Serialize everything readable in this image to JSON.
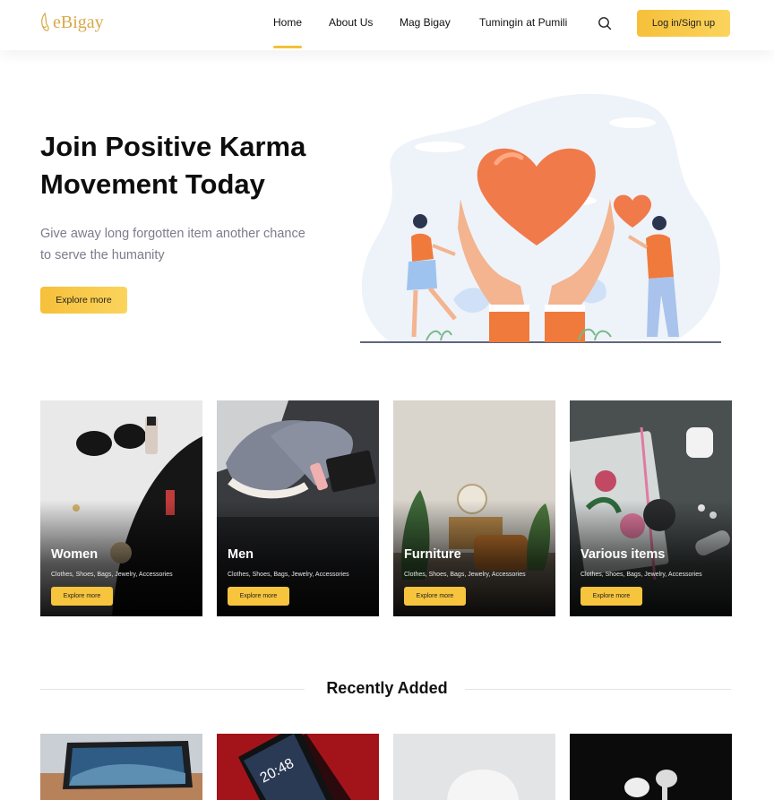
{
  "header": {
    "logo_text": "eBigay",
    "nav": [
      {
        "label": "Home",
        "active": true
      },
      {
        "label": "About Us",
        "active": false
      },
      {
        "label": "Mag Bigay",
        "active": false
      },
      {
        "label": "Tumingin at Pumili",
        "active": false
      }
    ],
    "search_icon": "search-icon",
    "login_label": "Log in/Sign up"
  },
  "hero": {
    "title": "Join Positive Karma Movement Today",
    "subtitle": "Give away long forgotten item another chance to serve the humanity",
    "button_label": "Explore more"
  },
  "categories": [
    {
      "name": "Women",
      "description": "Clothes, Shoes, Bags, Jewelry, Accessories",
      "button_label": "Explore more"
    },
    {
      "name": "Men",
      "description": "Clothes, Shoes, Bags, Jewelry, Accessories",
      "button_label": "Explore more"
    },
    {
      "name": "Furniture",
      "description": "Clothes, Shoes, Bags, Jewelry, Accessories",
      "button_label": "Explore more"
    },
    {
      "name": "Various items",
      "description": "Clothes, Shoes, Bags, Jewelry, Accessories",
      "button_label": "Explore more"
    }
  ],
  "recently_added": {
    "title": "Recently Added",
    "phone_clock": "20:48"
  },
  "colors": {
    "accent": "#f6c03a",
    "logo": "#d9a84a",
    "subtitle": "#7c7c8c"
  }
}
